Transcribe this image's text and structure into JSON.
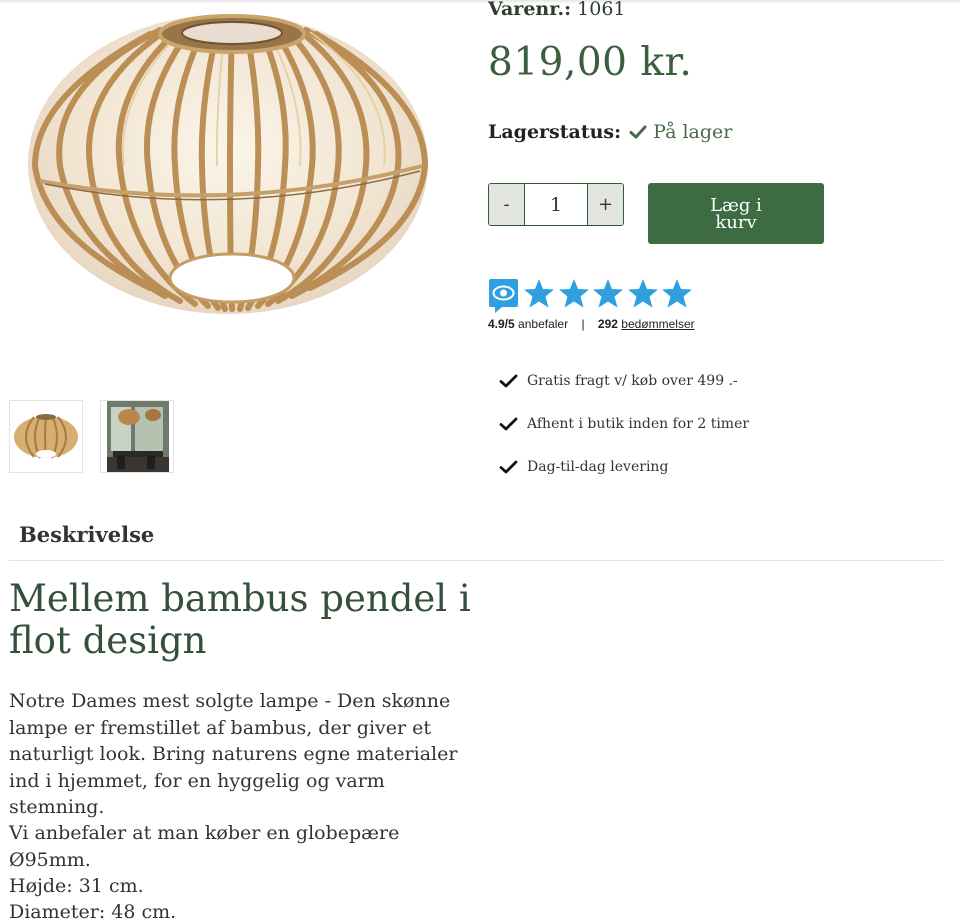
{
  "product": {
    "sku_label": "Varenr.:",
    "sku_value": "1061",
    "price": "819,00 kr.",
    "stock_label": "Lagerstatus:",
    "stock_value": "På lager"
  },
  "cart": {
    "minus": "-",
    "quantity": "1",
    "plus": "+",
    "add_label": "Læg i kurv"
  },
  "rating": {
    "score": "4.9/5",
    "recommends": "anbefaler",
    "separator": "|",
    "count": "292",
    "reviews_link": "bedømmelser",
    "stars": 5
  },
  "usps": [
    "Gratis fragt v/ køb over 499 .-",
    "Afhent i butik inden for 2 timer",
    "Dag-til-dag levering"
  ],
  "tabs": {
    "description": "Beskrivelse"
  },
  "description": {
    "heading": "Mellem bambus pendel i flot design",
    "paragraph1": "Notre Dames mest solgte lampe - Den skønne lampe er fremstillet af bambus, der giver et naturligt look. Bring naturens egne materialer ind i hjemmet, for en hyggelig og varm stemning.",
    "paragraph2": "Vi anbefaler at man køber en globepære Ø95mm.",
    "height": "Højde: 31 cm.",
    "diameter": "Diameter: 48 cm."
  },
  "colors": {
    "brand_green": "#3d6b42",
    "price_green": "#3a5e3e",
    "star_blue": "#2f9fe0"
  }
}
